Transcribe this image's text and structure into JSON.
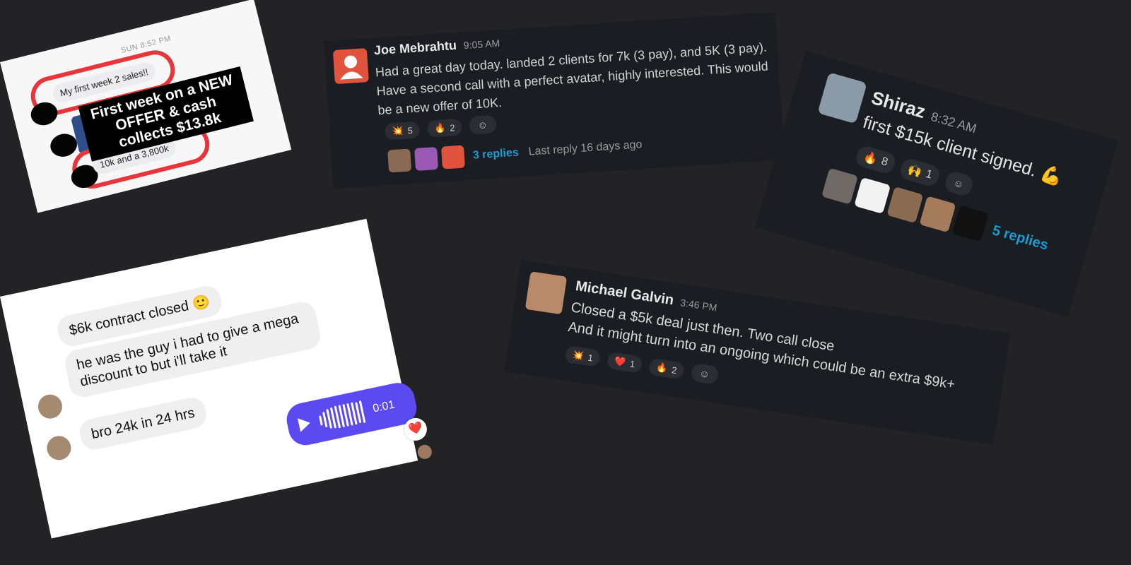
{
  "card_imessage": {
    "timestamp": "SUN 8:52 PM",
    "message_1": "My first week 2 sales!!",
    "message_2": "10k and a 3,800k",
    "overlay": "First week on a NEW OFFER & cash collects $13.8k"
  },
  "card_joe": {
    "author": "Joe Mebrahtu",
    "time": "9:05 AM",
    "text": "Had a great day today. landed 2 clients for 7k (3 pay), and 5K (3 pay).  Have a second call with a perfect avatar, highly interested. This would be a new offer of 10K.",
    "reactions": [
      {
        "emoji": "💥",
        "count": "5"
      },
      {
        "emoji": "🔥",
        "count": "2"
      }
    ],
    "replies": "3 replies",
    "last_reply": "Last reply 16 days ago"
  },
  "card_shiraz": {
    "author": "Shiraz",
    "time": "8:32 AM",
    "text": "first $15k client signed. 💪",
    "reactions": [
      {
        "emoji": "🔥",
        "count": "8"
      },
      {
        "emoji": "🙌",
        "count": "1"
      }
    ],
    "replies": "5 replies"
  },
  "card_michael": {
    "author": "Michael Galvin",
    "time": "3:46 PM",
    "line_1": "Closed a $5k deal just then. Two call close",
    "line_2": "And it might turn into an ongoing which could be an extra $9k+",
    "reactions": [
      {
        "emoji": "💥",
        "count": "1"
      },
      {
        "emoji": "❤️",
        "count": "1"
      },
      {
        "emoji": "🔥",
        "count": "2"
      }
    ]
  },
  "card_dm": {
    "message_1": "$6k contract closed 🙂",
    "message_2": "he was the guy i had to give a mega discount to but i'll take it",
    "message_3": "bro 24k in 24 hrs",
    "voice_duration": "0:01",
    "heart": "❤️"
  },
  "colors": {
    "background": "#232325",
    "slack_bg": "#1a1d21",
    "link_blue": "#1d9bd1",
    "highlight_red": "#e8343b",
    "voice_purple": "#5b4af0"
  }
}
